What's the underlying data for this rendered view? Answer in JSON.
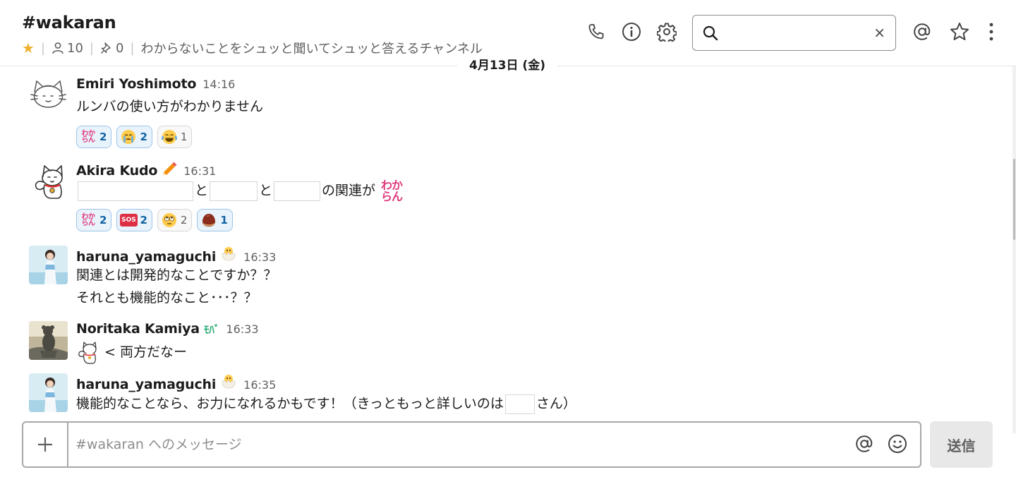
{
  "channel": {
    "name": "#wakaran",
    "member_count": "10",
    "pin_count": "0",
    "topic": "わからないことをシュッと聞いてシュッと答えるチャンネル"
  },
  "header": {
    "search_value": "",
    "clear_label": "×"
  },
  "date_divider": "4月13日 (金)",
  "emoji_text": {
    "wakaran_line1": "わか",
    "wakaran_line2": "らん",
    "sos": "SOS",
    "mobile": "ﾓﾊﾞ"
  },
  "messages": [
    {
      "author": "Emiri Yoshimoto",
      "time": "14:16",
      "lines": [
        "ルンバの使い方がわかりません"
      ],
      "reactions": [
        {
          "emoji": "wakaran",
          "count": "2",
          "mine": true
        },
        {
          "emoji": "sob",
          "count": "2",
          "mine": true
        },
        {
          "emoji": "joy",
          "count": "1",
          "mine": false
        }
      ]
    },
    {
      "author": "Akira Kudo",
      "status_emoji": "pencil",
      "time": "16:31",
      "text_parts": [
        "と",
        "と",
        "の関連が"
      ],
      "reactions": [
        {
          "emoji": "wakaran",
          "count": "2",
          "mine": true
        },
        {
          "emoji": "sos",
          "count": "2",
          "mine": true
        },
        {
          "emoji": "rolling-eyes",
          "count": "2",
          "mine": false
        },
        {
          "emoji": "chestnut",
          "count": "1",
          "mine": true
        }
      ]
    },
    {
      "author": "haruna_yamaguchi",
      "status_emoji": "hatching-chick",
      "time": "16:33",
      "lines": [
        "関連とは開発的なことですか？？",
        "それとも機能的なこと･･･？？"
      ]
    },
    {
      "author": "Noritaka Kamiya",
      "status_emoji": "mobile",
      "time": "16:33",
      "text_after_emoji": "< 両方だなー"
    },
    {
      "author": "haruna_yamaguchi",
      "status_emoji": "hatching-chick",
      "time": "16:35",
      "text_parts": [
        "機能的なことなら、お力になれるかもです！（きっともっと詳しいのは",
        "さん）"
      ]
    }
  ],
  "composer": {
    "placeholder": "#wakaran へのメッセージ",
    "send_label": "送信"
  },
  "colors": {
    "accent_blue": "#1264a3",
    "wakaran_pink": "#e0387d",
    "star_yellow": "#ecb22e",
    "mobile_green": "#2bac76"
  }
}
